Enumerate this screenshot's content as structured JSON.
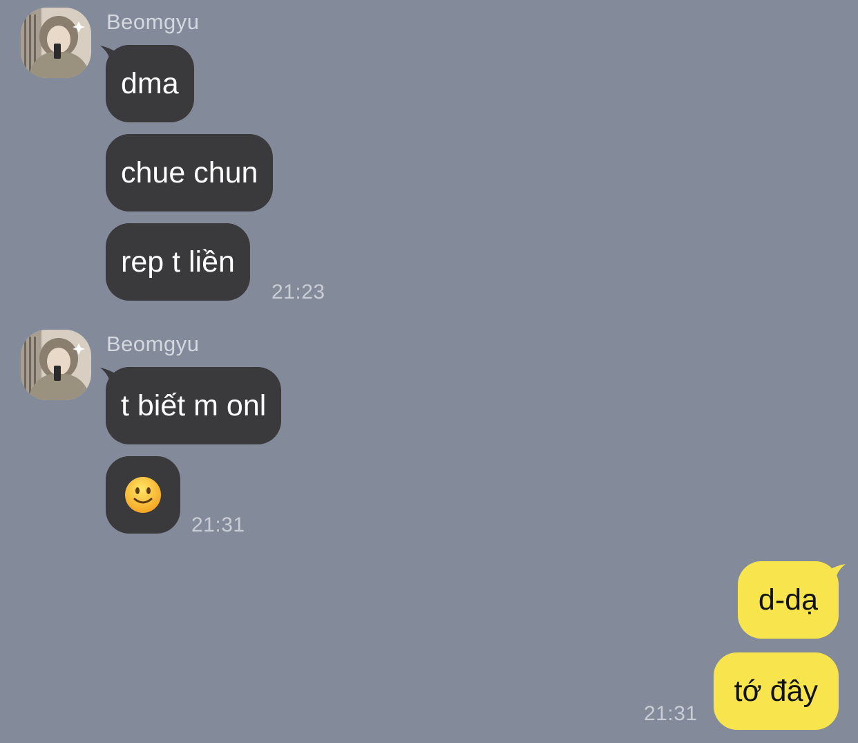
{
  "chat": {
    "groups": [
      {
        "sender": "Beomgyu",
        "messages": [
          "dma",
          "chue chun",
          "rep t liền"
        ],
        "time": "21:23"
      },
      {
        "sender": "Beomgyu",
        "messages": [
          "t biết m onl"
        ],
        "emoji_message": "slightly-smiling-face-icon",
        "time": "21:31"
      }
    ],
    "outgoing": {
      "messages": [
        "d-dạ",
        "tớ đây"
      ],
      "time": "21:31"
    }
  },
  "colors": {
    "background": "#838B9A",
    "incoming_bubble": "#3A3A3C",
    "outgoing_bubble": "#F8E44D"
  }
}
